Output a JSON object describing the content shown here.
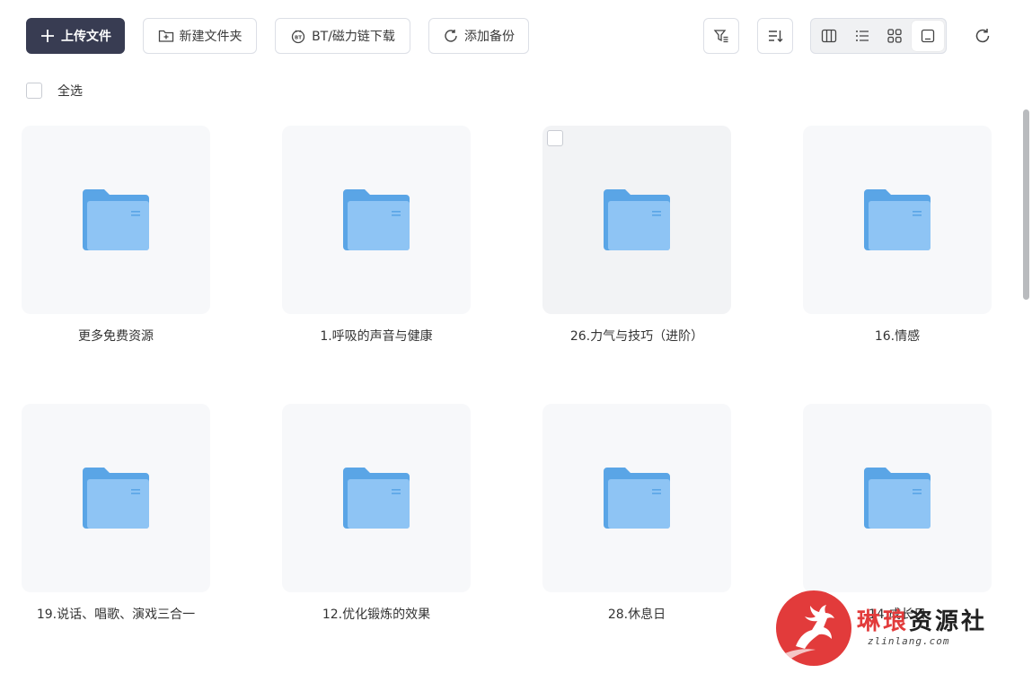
{
  "toolbar": {
    "upload_label": "上传文件",
    "new_folder_label": "新建文件夹",
    "bt_label": "BT/磁力链下载",
    "backup_label": "添加备份"
  },
  "select_all": {
    "label": "全选"
  },
  "files": [
    {
      "name": "更多免费资源"
    },
    {
      "name": "1.呼吸的声音与健康"
    },
    {
      "name": "26.力气与技巧（进阶）"
    },
    {
      "name": "16.情感"
    },
    {
      "name": "19.说话、唱歌、演戏三合一"
    },
    {
      "name": "12.优化锻炼的效果"
    },
    {
      "name": "28.休息日"
    },
    {
      "name": "14.成长日"
    }
  ],
  "watermark": {
    "title_red": "琳琅",
    "title_rest": "资源社",
    "url": "zlinlang.com"
  },
  "colors": {
    "primary": "#383c52",
    "folder": "#7bb8ef",
    "accent_red": "#e23b3b"
  }
}
